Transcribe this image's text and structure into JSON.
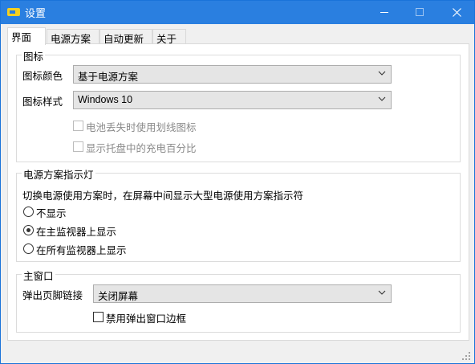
{
  "window": {
    "title": "设置"
  },
  "tabs": [
    "界面",
    "电源方案",
    "自动更新",
    "关于"
  ],
  "icon_group": {
    "title": "图标",
    "color_label": "图标颜色",
    "color_value": "基于电源方案",
    "style_label": "图标样式",
    "style_value": "Windows 10",
    "checkbox_lost_battery": "电池丢失时使用划线图标",
    "checkbox_tray_percent": "显示托盘中的充电百分比"
  },
  "indicator_group": {
    "title": "电源方案指示灯",
    "description": "切换电源使用方案时，在屏幕中间显示大型电源使用方案指示符",
    "radio_none": "不显示",
    "radio_main": "在主监视器上显示",
    "radio_all": "在所有监视器上显示",
    "selected": "radio_main"
  },
  "main_window_group": {
    "title": "主窗口",
    "footer_label": "弹出页脚链接",
    "footer_value": "关闭屏幕",
    "checkbox_border": "禁用弹出窗口边框"
  },
  "colors": {
    "titlebar": "#2a7fe0",
    "accent": "#1a73d9"
  },
  "icons": [
    "app-icon",
    "minimize-icon",
    "maximize-icon",
    "close-icon",
    "chevron-down-icon",
    "resize-grip-icon"
  ]
}
